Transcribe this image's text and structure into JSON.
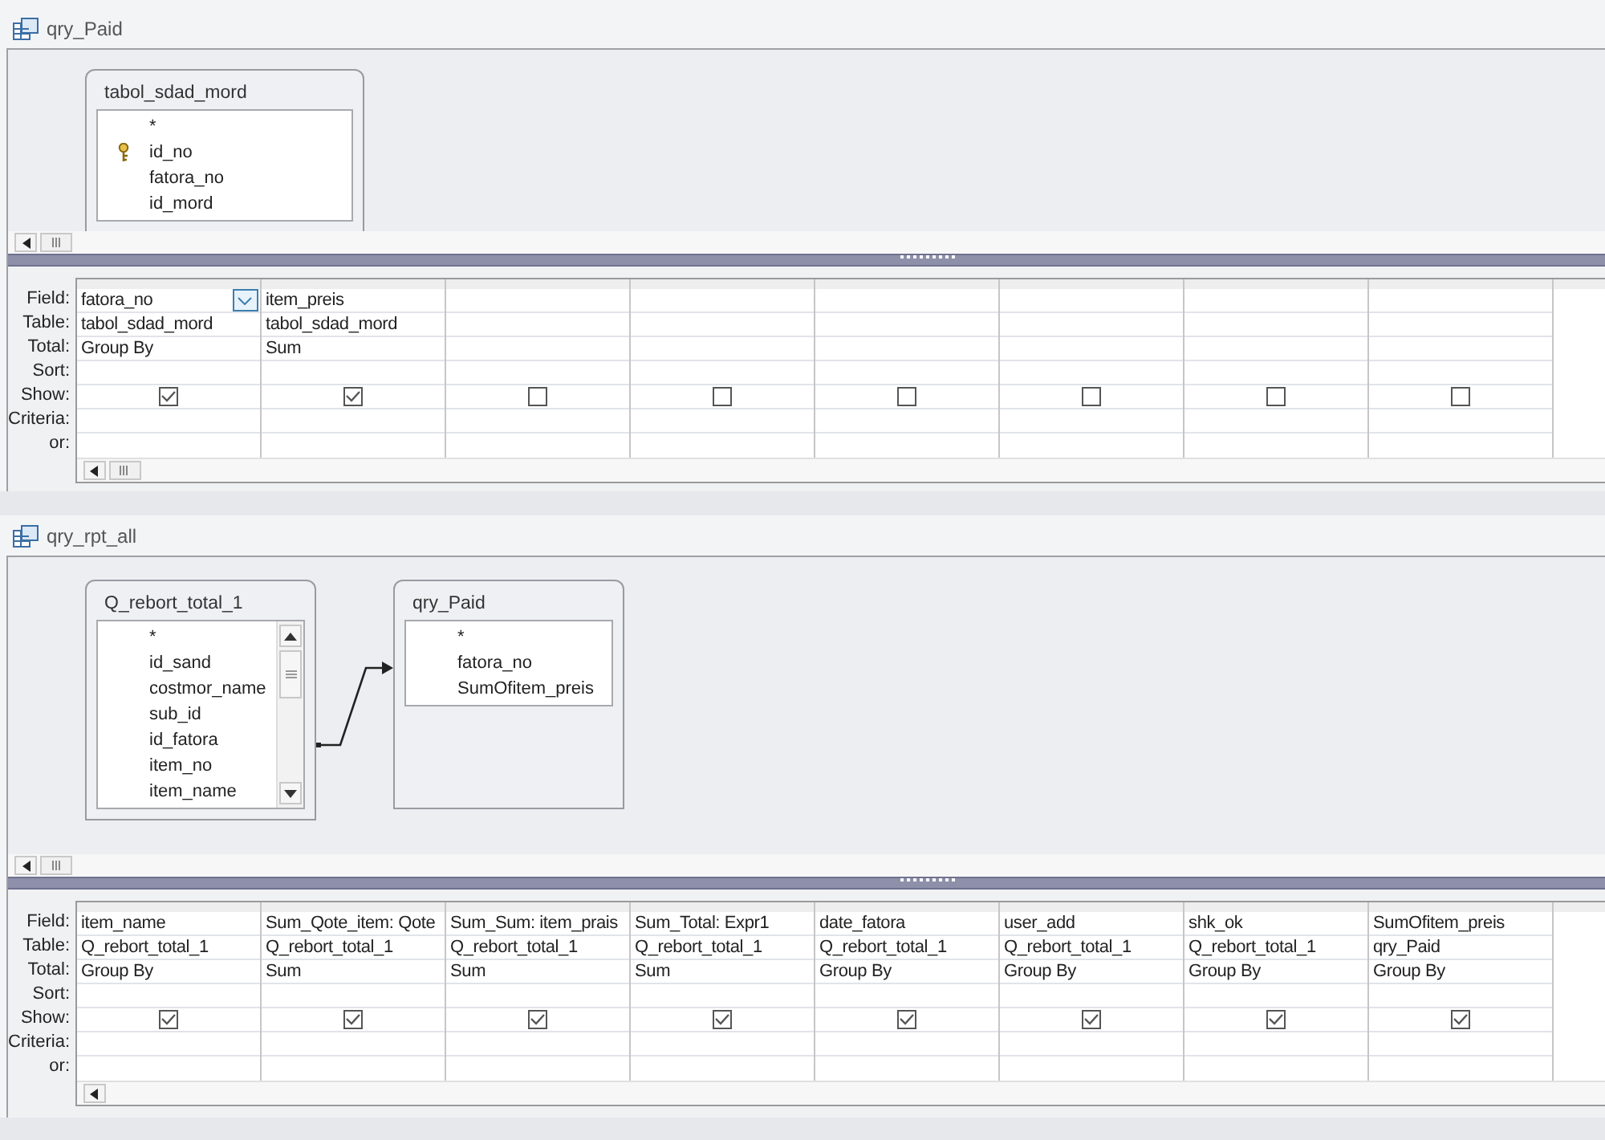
{
  "queries": [
    {
      "title": "qry_Paid",
      "joined": false,
      "tables": [
        {
          "name": "tabol_sdad_mord",
          "scrollbar": false,
          "fields": [
            {
              "name": "*",
              "key": false
            },
            {
              "name": "id_no",
              "key": true
            },
            {
              "name": "fatora_no",
              "key": false
            },
            {
              "name": "id_mord",
              "key": false
            }
          ]
        }
      ],
      "row_labels": [
        "Field:",
        "Table:",
        "Total:",
        "Sort:",
        "Show:",
        "Criteria:",
        "or:"
      ],
      "columns": [
        {
          "field": "fatora_no",
          "table": "tabol_sdad_mord",
          "total": "Group By",
          "show": true,
          "active": true
        },
        {
          "field": "item_preis",
          "table": "tabol_sdad_mord",
          "total": "Sum",
          "show": true,
          "active": false
        },
        {
          "show": false,
          "active": false
        },
        {
          "show": false,
          "active": false
        },
        {
          "show": false,
          "active": false
        },
        {
          "show": false,
          "active": false
        },
        {
          "show": false,
          "active": false
        },
        {
          "show": false,
          "active": false
        }
      ]
    },
    {
      "title": "qry_rpt_all",
      "joined": true,
      "tables": [
        {
          "name": "Q_rebort_total_1",
          "scrollbar": true,
          "fields": [
            {
              "name": "*",
              "key": false
            },
            {
              "name": "id_sand",
              "key": false
            },
            {
              "name": "costmor_name",
              "key": false
            },
            {
              "name": "sub_id",
              "key": false
            },
            {
              "name": "id_fatora",
              "key": false
            },
            {
              "name": "item_no",
              "key": false
            },
            {
              "name": "item_name",
              "key": false
            }
          ]
        },
        {
          "name": "qry_Paid",
          "scrollbar": false,
          "fields": [
            {
              "name": "*",
              "key": false
            },
            {
              "name": "fatora_no",
              "key": false
            },
            {
              "name": "SumOfitem_preis",
              "key": false
            }
          ]
        }
      ],
      "row_labels": [
        "Field:",
        "Table:",
        "Total:",
        "Sort:",
        "Show:",
        "Criteria:",
        "or:"
      ],
      "columns": [
        {
          "field": "item_name",
          "table": "Q_rebort_total_1",
          "total": "Group By",
          "show": true,
          "active": false
        },
        {
          "field": "Sum_Qote_item: Qote",
          "table": "Q_rebort_total_1",
          "total": "Sum",
          "show": true,
          "active": false
        },
        {
          "field": "Sum_Sum: item_prais",
          "table": "Q_rebort_total_1",
          "total": "Sum",
          "show": true,
          "active": false
        },
        {
          "field": "Sum_Total: Expr1",
          "table": "Q_rebort_total_1",
          "total": "Sum",
          "show": true,
          "active": false
        },
        {
          "field": "date_fatora",
          "table": "Q_rebort_total_1",
          "total": "Group By",
          "show": true,
          "active": false
        },
        {
          "field": "user_add",
          "table": "Q_rebort_total_1",
          "total": "Group By",
          "show": true,
          "active": false
        },
        {
          "field": "shk_ok",
          "table": "Q_rebort_total_1",
          "total": "Group By",
          "show": true,
          "active": false
        },
        {
          "field": "SumOfitem_preis",
          "table": "qry_Paid",
          "total": "Group By",
          "show": true,
          "active": false
        }
      ]
    }
  ]
}
